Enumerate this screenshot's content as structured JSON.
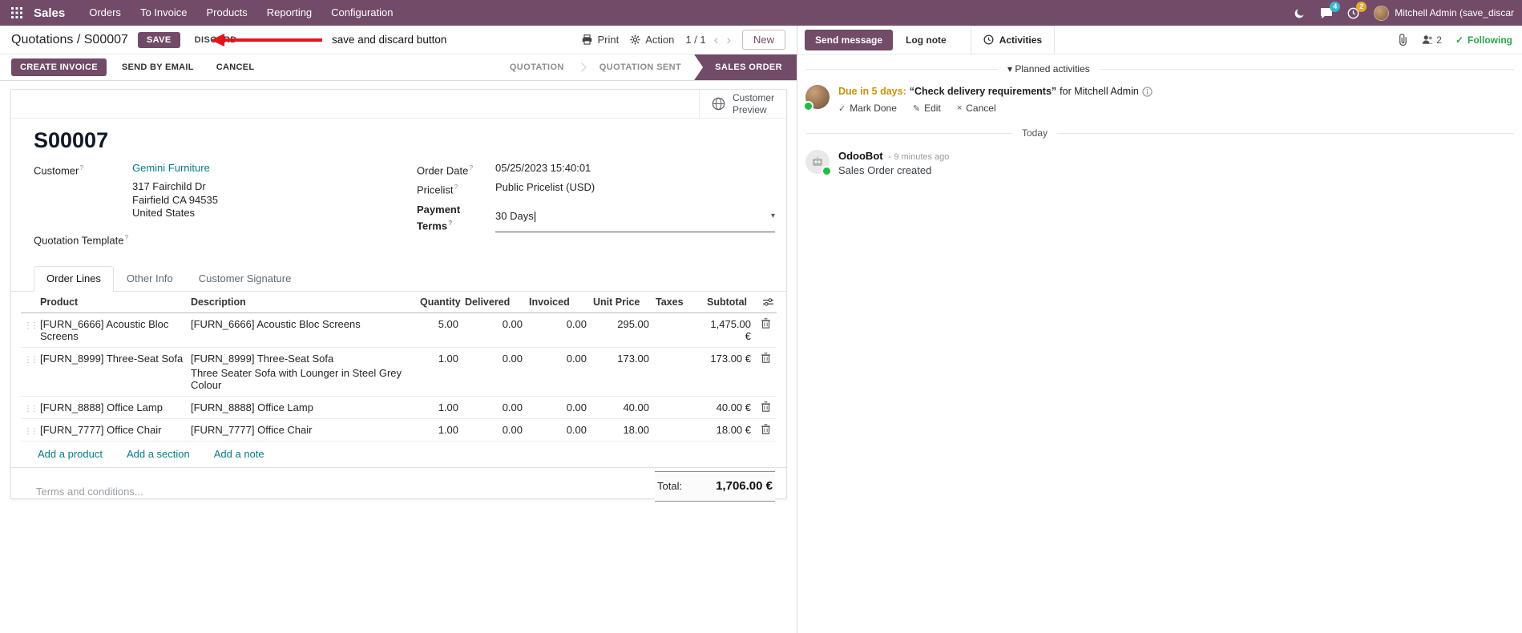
{
  "colors": {
    "brand": "#714B67",
    "link": "#017e84",
    "annotation_arrow": "#e8131a",
    "following_green": "#28a745",
    "due_warning": "#d09000"
  },
  "navbar": {
    "app_name": "Sales",
    "menus": [
      "Orders",
      "To Invoice",
      "Products",
      "Reporting",
      "Configuration"
    ],
    "messages_badge": "4",
    "activities_badge": "2",
    "user_name": "Mitchell Admin (save_discar"
  },
  "breadcrumb": {
    "parent": "Quotations",
    "separator": "/",
    "current": "S00007",
    "save_label": "SAVE",
    "discard_label": "DISCARD"
  },
  "annotation": {
    "label": "save and discard button"
  },
  "control_panel": {
    "print_label": "Print",
    "action_label": "Action",
    "pager": "1 / 1",
    "prev": "‹",
    "next": "›",
    "new_label": "New"
  },
  "statusbar": {
    "actions": [
      "CREATE INVOICE",
      "SEND BY EMAIL",
      "CANCEL"
    ],
    "stages": [
      {
        "label": "QUOTATION",
        "active": false
      },
      {
        "label": "QUOTATION SENT",
        "active": false
      },
      {
        "label": "SALES ORDER",
        "active": true
      }
    ]
  },
  "sheet": {
    "preview_button": {
      "line1": "Customer",
      "line2": "Preview"
    },
    "title": "S00007",
    "fields": {
      "customer_label": "Customer",
      "customer_value": "Gemini Furniture",
      "address": [
        "317 Fairchild Dr",
        "Fairfield CA 94535",
        "United States"
      ],
      "quotation_template_label": "Quotation Template",
      "order_date_label": "Order Date",
      "order_date_value": "05/25/2023 15:40:01",
      "pricelist_label": "Pricelist",
      "pricelist_value": "Public Pricelist (USD)",
      "payment_terms_label": "Payment Terms",
      "payment_terms_value": "30 Days",
      "help_mark": "?"
    },
    "tabs": [
      "Order Lines",
      "Other Info",
      "Customer Signature"
    ],
    "table": {
      "headers": [
        "Product",
        "Description",
        "Quantity",
        "Delivered",
        "Invoiced",
        "Unit Price",
        "Taxes",
        "Subtotal"
      ],
      "rows": [
        {
          "product": "[FURN_6666] Acoustic Bloc Screens",
          "description": "[FURN_6666] Acoustic Bloc Screens",
          "description2": "",
          "quantity": "5.00",
          "delivered": "0.00",
          "invoiced": "0.00",
          "unit_price": "295.00",
          "taxes": "",
          "subtotal": "1,475.00 €"
        },
        {
          "product": "[FURN_8999] Three-Seat Sofa",
          "description": "[FURN_8999] Three-Seat Sofa",
          "description2": "Three Seater Sofa with Lounger in Steel Grey Colour",
          "quantity": "1.00",
          "delivered": "0.00",
          "invoiced": "0.00",
          "unit_price": "173.00",
          "taxes": "",
          "subtotal": "173.00 €"
        },
        {
          "product": "[FURN_8888] Office Lamp",
          "description": "[FURN_8888] Office Lamp",
          "description2": "",
          "quantity": "1.00",
          "delivered": "0.00",
          "invoiced": "0.00",
          "unit_price": "40.00",
          "taxes": "",
          "subtotal": "40.00 €"
        },
        {
          "product": "[FURN_7777] Office Chair",
          "description": "[FURN_7777] Office Chair",
          "description2": "",
          "quantity": "1.00",
          "delivered": "0.00",
          "invoiced": "0.00",
          "unit_price": "18.00",
          "taxes": "",
          "subtotal": "18.00 €"
        }
      ]
    },
    "add_links": [
      "Add a product",
      "Add a section",
      "Add a note"
    ],
    "terms_placeholder": "Terms and conditions...",
    "total_label": "Total:",
    "total_value": "1,706.00 €"
  },
  "chatter": {
    "send_message": "Send message",
    "log_note": "Log note",
    "activities": "Activities",
    "followers_count": "2",
    "following_check": "✓",
    "following": "Following",
    "planned_header": "Planned activities",
    "planned_caret": "▾",
    "activity": {
      "due": "Due in 5 days:",
      "summary": "“Check delivery requirements”",
      "assignee": "for Mitchell Admin",
      "mark_done_icon": "✓",
      "mark_done": "Mark Done",
      "edit_icon": "✎",
      "edit": "Edit",
      "cancel_icon": "×",
      "cancel": "Cancel"
    },
    "today_label": "Today",
    "message": {
      "author": "OdooBot",
      "time": "- 9 minutes ago",
      "body": "Sales Order created"
    }
  }
}
